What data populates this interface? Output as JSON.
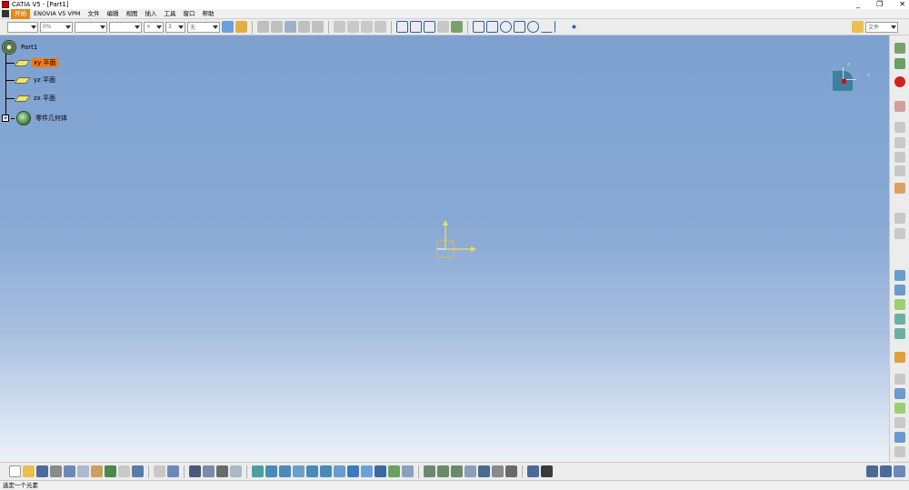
{
  "window": {
    "title": "CATIA V5 - [Part1]",
    "controls": [
      "_",
      "❐",
      "✕"
    ]
  },
  "menubar": {
    "items": [
      "开始",
      "ENOVIA V5 VPM",
      "文件",
      "编辑",
      "视图",
      "插入",
      "工具",
      "窗口",
      "帮助"
    ],
    "active_index": 0
  },
  "toolbar_top": {
    "combo_values": [
      "",
      "0%",
      "",
      "",
      "×",
      "3",
      "无"
    ],
    "folder_label": "文件"
  },
  "tree": {
    "root": "Part1",
    "children": [
      {
        "label": "xy 平面",
        "selected": true
      },
      {
        "label": "yz 平面",
        "selected": false
      },
      {
        "label": "zx 平面",
        "selected": false
      },
      {
        "label": "零件几何体",
        "selected": false
      }
    ]
  },
  "compass": {
    "labels": {
      "z": "z",
      "x": "x",
      "y": "y"
    }
  },
  "statusbar": {
    "text": "选定一个元素"
  },
  "colors": {
    "viewport_top": "#7ea1d0",
    "viewport_bottom": "#ecf1f8",
    "selection": "#f07a1a",
    "menu_active": "#e08a1c",
    "compass": "#3f7fa0"
  }
}
